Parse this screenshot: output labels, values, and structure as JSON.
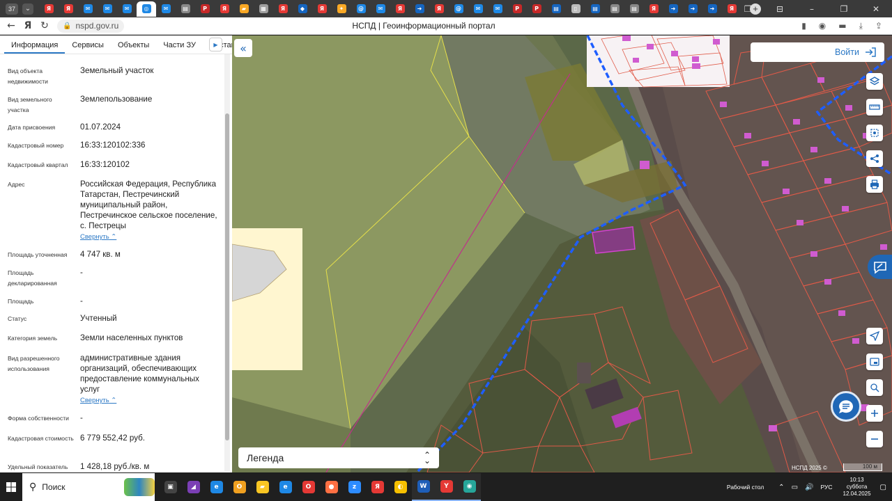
{
  "browser": {
    "tab_count": "37",
    "tabs": [
      {
        "icon": "yandex-icon",
        "color": "#e53935",
        "glyph": "Я"
      },
      {
        "icon": "yandex-icon",
        "color": "#e53935",
        "glyph": "Я"
      },
      {
        "icon": "mail-icon",
        "color": "#1e88e5",
        "glyph": "✉"
      },
      {
        "icon": "mail-icon",
        "color": "#1e88e5",
        "glyph": "✉"
      },
      {
        "icon": "mail-icon",
        "color": "#1e88e5",
        "glyph": "✉"
      },
      {
        "icon": "nspd-icon",
        "color": "#1e88e5",
        "glyph": "◎",
        "active": true
      },
      {
        "icon": "mail-icon",
        "color": "#1e88e5",
        "glyph": "✉"
      },
      {
        "icon": "doc-icon",
        "color": "#888888",
        "glyph": "▤"
      },
      {
        "icon": "pdf-icon",
        "color": "#c62828",
        "glyph": "P"
      },
      {
        "icon": "yandex-icon",
        "color": "#e53935",
        "glyph": "Я"
      },
      {
        "icon": "folder-icon",
        "color": "#f9a825",
        "glyph": "▰"
      },
      {
        "icon": "grid-icon",
        "color": "#9e9e9e",
        "glyph": "▦"
      },
      {
        "icon": "yandex-icon",
        "color": "#e53935",
        "glyph": "Я"
      },
      {
        "icon": "shield-icon",
        "color": "#1565c0",
        "glyph": "◆"
      },
      {
        "icon": "yandex-icon",
        "color": "#e53935",
        "glyph": "Я"
      },
      {
        "icon": "emblem-icon",
        "color": "#f9a825",
        "glyph": "✦"
      },
      {
        "icon": "at-icon",
        "color": "#1e88e5",
        "glyph": "@"
      },
      {
        "icon": "mail-icon",
        "color": "#1e88e5",
        "glyph": "✉"
      },
      {
        "icon": "yandex-icon",
        "color": "#e53935",
        "glyph": "Я"
      },
      {
        "icon": "arrow-icon",
        "color": "#1565c0",
        "glyph": "➜"
      },
      {
        "icon": "yandex-icon",
        "color": "#e53935",
        "glyph": "Я"
      },
      {
        "icon": "at-icon",
        "color": "#1e88e5",
        "glyph": "@"
      },
      {
        "icon": "mail-icon",
        "color": "#1e88e5",
        "glyph": "✉"
      },
      {
        "icon": "mail-icon",
        "color": "#1e88e5",
        "glyph": "✉"
      },
      {
        "icon": "pdf-icon",
        "color": "#c62828",
        "glyph": "P"
      },
      {
        "icon": "pdf-icon",
        "color": "#c62828",
        "glyph": "P"
      },
      {
        "icon": "doc-icon",
        "color": "#1565c0",
        "glyph": "▤"
      },
      {
        "icon": "file-icon",
        "color": "#bdbdbd",
        "glyph": "▯"
      },
      {
        "icon": "doc-icon",
        "color": "#1565c0",
        "glyph": "▤"
      },
      {
        "icon": "doc-icon",
        "color": "#888888",
        "glyph": "▤"
      },
      {
        "icon": "doc-icon",
        "color": "#888888",
        "glyph": "▤"
      },
      {
        "icon": "yandex-icon",
        "color": "#e53935",
        "glyph": "Я"
      },
      {
        "icon": "arrow-icon",
        "color": "#1565c0",
        "glyph": "➜"
      },
      {
        "icon": "arrow-icon",
        "color": "#1565c0",
        "glyph": "➜"
      },
      {
        "icon": "arrow-icon",
        "color": "#1565c0",
        "glyph": "➜"
      },
      {
        "icon": "yandex-icon",
        "color": "#e53935",
        "glyph": "Я"
      }
    ],
    "url": "nspd.gov.ru",
    "page_title": "НСПД | Геоинформационный портал"
  },
  "panel": {
    "tabs": [
      "Информация",
      "Сервисы",
      "Объекты",
      "Части ЗУ",
      "Состав"
    ],
    "collapse_label": "Свернуть",
    "props": [
      {
        "label": "Вид объекта недвижимости",
        "value": "Земельный участок"
      },
      {
        "label": "Вид земельного участка",
        "value": "Землепользование"
      },
      {
        "label": "Дата присвоения",
        "value": "01.07.2024"
      },
      {
        "label": "Кадастровый номер",
        "value": "16:33:120102:336"
      },
      {
        "label": "Кадастровый квартал",
        "value": "16:33:120102"
      },
      {
        "label": "Адрес",
        "value": "Российская Федерация, Республика Татарстан, Пестречинский муниципальный район, Пестречинское сельское поселение, с. Пестрецы",
        "collapse": true
      },
      {
        "label": "Площадь уточненная",
        "value": "4 747 кв. м"
      },
      {
        "label": "Площадь декларированная",
        "value": "-"
      },
      {
        "label": "Площадь",
        "value": "-"
      },
      {
        "label": "Статус",
        "value": "Учтенный"
      },
      {
        "label": "Категория земель",
        "value": "Земли населенных пунктов"
      },
      {
        "label": "Вид разрешенного использования",
        "value": "административные здания организаций, обеспечивающих предоставление коммунальных услуг",
        "collapse": true
      },
      {
        "label": "Форма собственности",
        "value": "-"
      },
      {
        "label": "Кадастровая стоимость",
        "value": "6 779 552,42 руб."
      },
      {
        "label": "Удельный показатель",
        "value": "1 428,18 руб./кв. м"
      }
    ]
  },
  "map": {
    "login_label": "Войти",
    "legend_label": "Легенда",
    "copyright": "НСПД 2025 ©",
    "scale_label": "100 м"
  },
  "taskbar": {
    "search_label": "Поиск",
    "desktop_label": "Рабочий стол",
    "lang": "РУС",
    "time": "10:13",
    "weekday": "суббота",
    "date": "12.04.2025",
    "apps": [
      {
        "icon": "task-view-icon",
        "color": "#444444",
        "glyph": "▣"
      },
      {
        "icon": "app-icon",
        "color": "#7b3fb5",
        "glyph": "◢"
      },
      {
        "icon": "edge-icon",
        "color": "#1e88e5",
        "glyph": "e"
      },
      {
        "icon": "outlook-icon",
        "color": "#f0a020",
        "glyph": "O"
      },
      {
        "icon": "explorer-icon",
        "color": "#f9c623",
        "glyph": "▰"
      },
      {
        "icon": "ie-icon",
        "color": "#1e88e5",
        "glyph": "e"
      },
      {
        "icon": "opera-icon",
        "color": "#e53935",
        "glyph": "O"
      },
      {
        "icon": "firefox-icon",
        "color": "#ff7043",
        "glyph": "●"
      },
      {
        "icon": "zoom-icon",
        "color": "#2d8cff",
        "glyph": "z"
      },
      {
        "icon": "yandex-icon",
        "color": "#e53935",
        "glyph": "Я"
      },
      {
        "icon": "app-icon",
        "color": "#f6c000",
        "glyph": "◐"
      },
      {
        "icon": "word-icon",
        "color": "#1e5eb8",
        "glyph": "W",
        "on": true
      },
      {
        "icon": "yandex-browser-icon",
        "color": "#e53935",
        "glyph": "Y",
        "on": true
      },
      {
        "icon": "app-icon",
        "color": "#26a69a",
        "glyph": "◉",
        "on": true
      }
    ]
  }
}
